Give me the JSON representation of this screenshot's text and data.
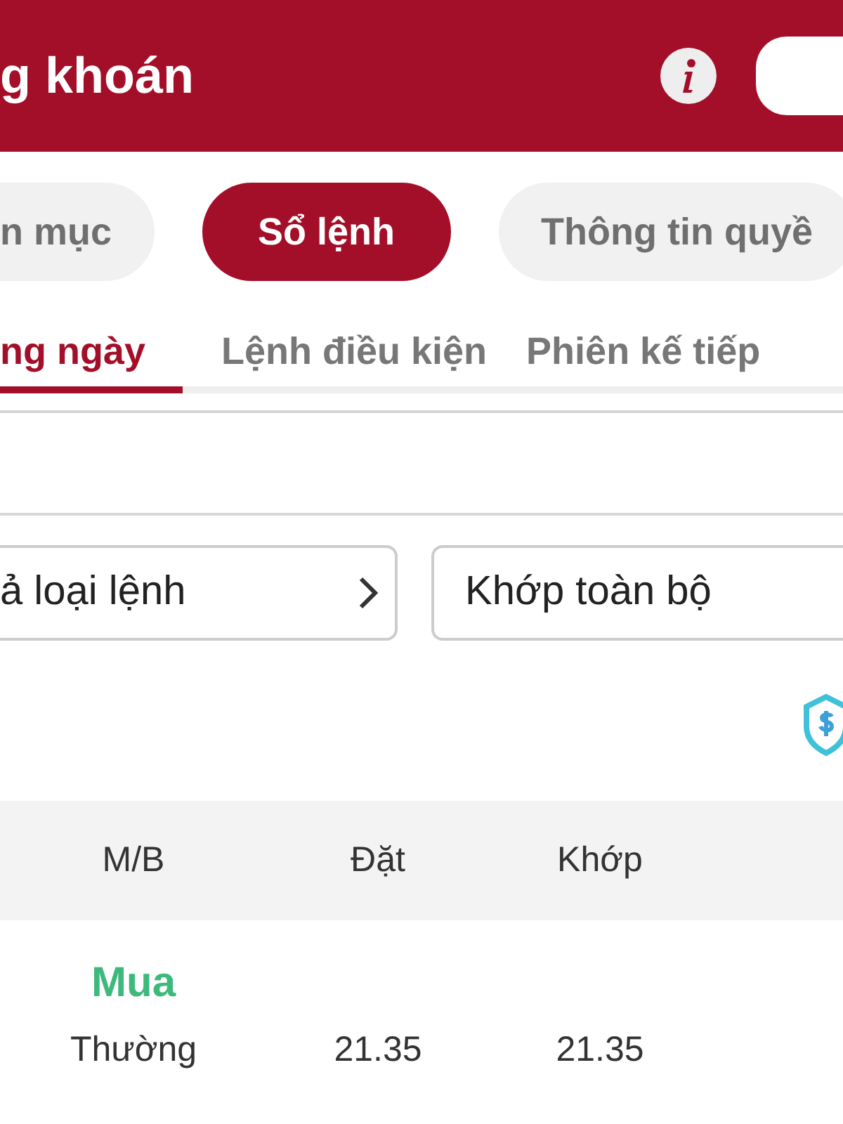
{
  "header": {
    "title": "g khoán"
  },
  "segments": [
    {
      "label": "n mục",
      "selected": false
    },
    {
      "label": "Sổ lệnh",
      "selected": true
    },
    {
      "label": "Thông tin quyề",
      "selected": false
    }
  ],
  "tabs": [
    {
      "label": "ng ngày",
      "selected": true
    },
    {
      "label": "Lệnh điều kiện",
      "selected": false
    },
    {
      "label": "Phiên kế tiếp",
      "selected": false
    }
  ],
  "filters": [
    {
      "value": "ả loại lệnh",
      "kind": "select"
    },
    {
      "value": "Khớp toàn bộ",
      "kind": "text"
    }
  ],
  "table": {
    "columns": [
      "M/B",
      "Đặt",
      "Khớp"
    ],
    "rows": [
      {
        "side": "Mua",
        "color": "#3dba7b",
        "cells": [
          "Thường",
          "21.35",
          "21.35"
        ]
      }
    ]
  }
}
